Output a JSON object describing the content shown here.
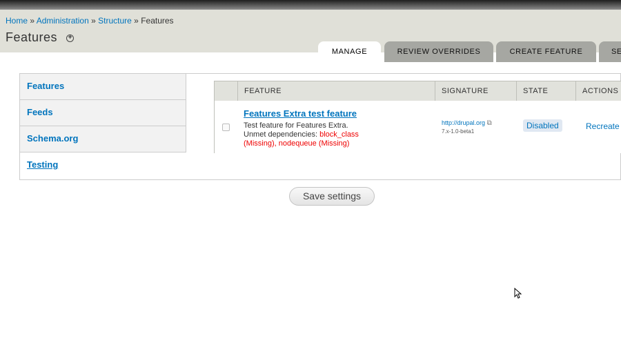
{
  "breadcrumb": {
    "items": [
      "Home",
      "Administration",
      "Structure"
    ],
    "separator": "»",
    "current": "Features"
  },
  "page": {
    "title": "Features"
  },
  "tabs": [
    {
      "label": "Manage",
      "active": true
    },
    {
      "label": "Review overrides",
      "active": false
    },
    {
      "label": "Create feature",
      "active": false
    },
    {
      "label": "Se",
      "active": false
    }
  ],
  "vertical_tabs": [
    {
      "label": "Features",
      "selected": false
    },
    {
      "label": "Feeds",
      "selected": false
    },
    {
      "label": "Schema.org",
      "selected": false
    },
    {
      "label": "Testing",
      "selected": true
    }
  ],
  "table": {
    "headers": [
      "Feature",
      "Signature",
      "State",
      "Actions"
    ],
    "rows": [
      {
        "title": "Features Extra test feature",
        "description": "Test feature for Features Extra.",
        "dependencies_label": "Unmet dependencies:",
        "dependencies_missing": "block_class (Missing), nodequeue (Missing)",
        "signature_link": "http://drupal.org",
        "signature_version": "7.x-1.0-beta1",
        "state": "Disabled",
        "action": "Recreate"
      }
    ]
  },
  "buttons": {
    "save": "Save settings"
  },
  "colors": {
    "link": "#0074bd",
    "error": "#e00000",
    "header_bg": "#e0e0d8",
    "tab_inactive": "#a6a7a2"
  },
  "icons": [
    "plus-circle-icon",
    "external-link-icon",
    "mouse-cursor-icon"
  ]
}
